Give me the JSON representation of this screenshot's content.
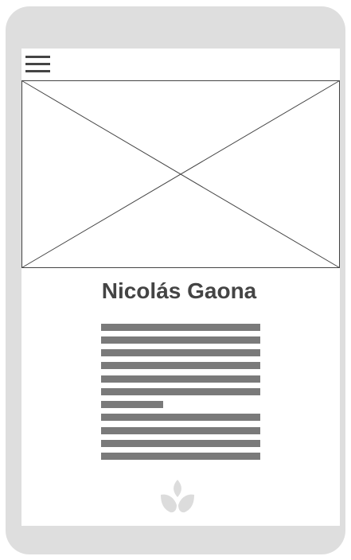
{
  "profile": {
    "name": "Nicolás Gaona"
  },
  "colors": {
    "frame": "#dedede",
    "screen": "#ffffff",
    "text": "#444444",
    "placeholder_line": "#7a7a7a",
    "logo": "#dcdcdc"
  },
  "icons": {
    "menu": "hamburger-menu-icon",
    "image": "image-placeholder-icon",
    "logo": "lotus-logo-icon"
  }
}
